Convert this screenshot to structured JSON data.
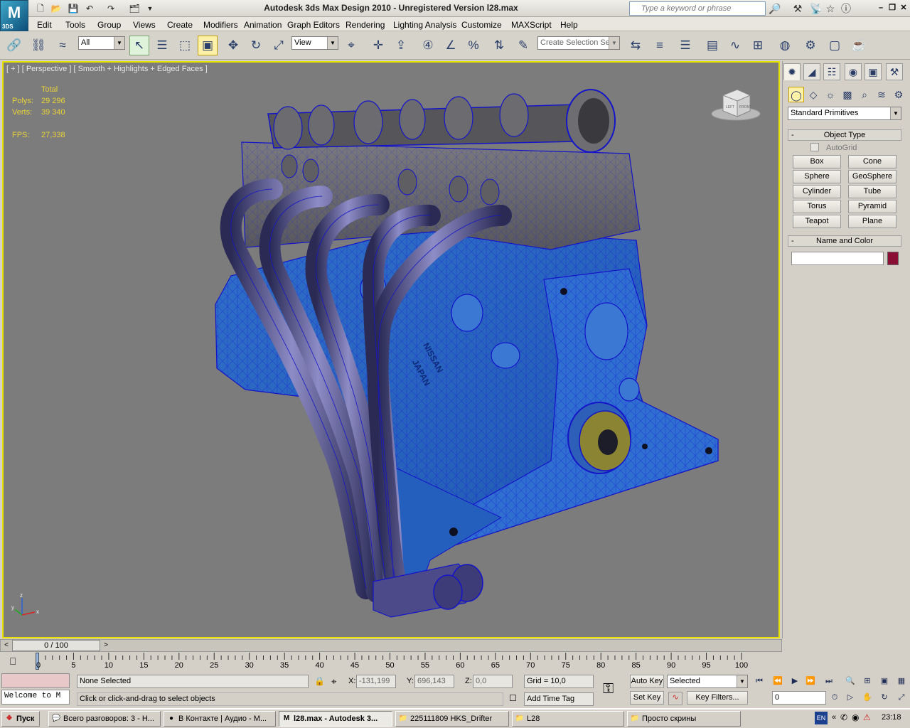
{
  "window": {
    "title": "Autodesk 3ds Max Design 2010  - Unregistered Version    l28.max",
    "search_placeholder": "Type a keyword or phrase",
    "logo_text": "3DS"
  },
  "menu": [
    "Edit",
    "Tools",
    "Group",
    "Views",
    "Create",
    "Modifiers",
    "Animation",
    "Graph Editors",
    "Rendering",
    "Lighting Analysis",
    "Customize",
    "MAXScript",
    "Help"
  ],
  "toolbar": {
    "selection_filter": "All",
    "reference_coord": "View",
    "named_selection": "Create Selection Se"
  },
  "viewport": {
    "label": "[ + ] [ Perspective ] [ Smooth + Highlights + Edged Faces ]",
    "stats": {
      "total_label": "Total",
      "polys_label": "Polys:",
      "polys_value": "29 296",
      "verts_label": "Verts:",
      "verts_value": "39 340",
      "fps_label": "FPS:",
      "fps_value": "27,338"
    },
    "viewcube_labels": [
      "LEFT",
      "FRONT"
    ],
    "axis_labels": [
      "z",
      "y",
      "x"
    ],
    "model_text": [
      "NISSAN",
      "JAPAN"
    ]
  },
  "command_panel": {
    "category": "Standard Primitives",
    "object_type_title": "Object Type",
    "autogrid_label": "AutoGrid",
    "primitives": [
      "Box",
      "Cone",
      "Sphere",
      "GeoSphere",
      "Cylinder",
      "Tube",
      "Torus",
      "Pyramid",
      "Teapot",
      "Plane"
    ],
    "name_color_title": "Name and Color",
    "object_color": "#8b0f34"
  },
  "timeline": {
    "frame_display": "0 / 100",
    "ticks": [
      "0",
      "5",
      "10",
      "15",
      "20",
      "25",
      "30",
      "35",
      "40",
      "45",
      "50",
      "55",
      "60",
      "65",
      "70",
      "75",
      "80",
      "85",
      "90",
      "95",
      "100"
    ]
  },
  "status": {
    "maxscript_listener": "Welcome to M",
    "selection_info": "None Selected",
    "prompt": "Click or click-and-drag to select objects",
    "x_label": "X:",
    "x_value": "-131,199",
    "y_label": "Y:",
    "y_value": "696,143",
    "z_label": "Z:",
    "z_value": "0,0",
    "grid": "Grid = 10,0",
    "add_time_tag": "Add Time Tag",
    "auto_key": "Auto Key",
    "set_key": "Set Key",
    "key_mode": "Selected",
    "key_filters": "Key Filters...",
    "current_frame": "0"
  },
  "taskbar": {
    "start": "Пуск",
    "tasks": [
      "Всего разговоров: 3 - Н...",
      "В Контакте | Аудио - М...",
      "l28.max - Autodesk 3...",
      "225111809 HKS_Drifter",
      "L28",
      "Просто скрины"
    ],
    "lang": "EN",
    "clock": "23:18"
  }
}
